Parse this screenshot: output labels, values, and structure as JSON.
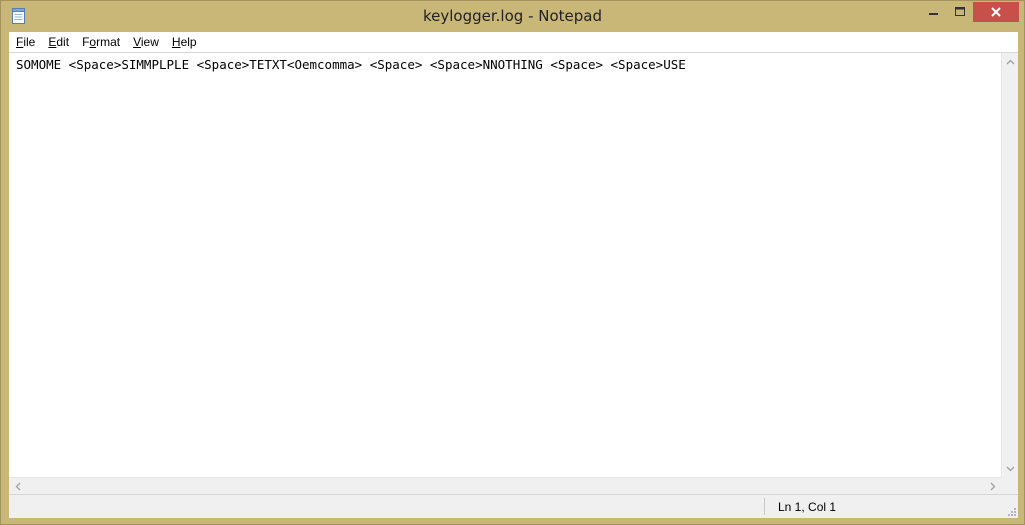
{
  "window": {
    "title": "keylogger.log - Notepad",
    "frame_color": "#c9b778",
    "close_color": "#c7504b"
  },
  "menu": {
    "items": [
      {
        "underline": "F",
        "rest": "ile"
      },
      {
        "underline": "E",
        "rest": "dit"
      },
      {
        "underline": "",
        "rest": "Format",
        "pre": "F",
        "mid": "o",
        "post": "rmat"
      },
      {
        "underline": "V",
        "rest": "iew"
      },
      {
        "underline": "H",
        "rest": "elp"
      }
    ]
  },
  "editor": {
    "text": "SOMOME <Space>SIMMPLPLE <Space>TETXT<Oemcomma> <Space> <Space>NNOTHING <Space> <Space>USE"
  },
  "status": {
    "position": "Ln 1, Col 1"
  },
  "icons": {
    "app": "notepad-icon",
    "minimize": "minimize-icon",
    "maximize": "maximize-icon",
    "close": "close-icon"
  }
}
